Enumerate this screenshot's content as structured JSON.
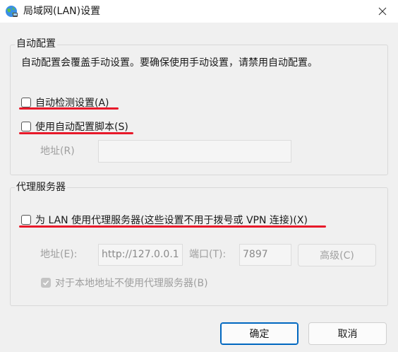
{
  "window": {
    "title": "局域网(LAN)设置",
    "icon": "globe-network-icon"
  },
  "auto_config": {
    "group_title": "自动配置",
    "description": "自动配置会覆盖手动设置。要确保使用手动设置，请禁用自动配置。",
    "auto_detect_label": "自动检测设置(A)",
    "auto_detect_checked": false,
    "use_script_label": "使用自动配置脚本(S)",
    "use_script_checked": false,
    "address_label": "地址(R)",
    "address_value": ""
  },
  "proxy": {
    "group_title": "代理服务器",
    "use_proxy_label": "为 LAN 使用代理服务器(这些设置不用于拨号或 VPN 连接)(X)",
    "use_proxy_checked": false,
    "address_label": "地址(E):",
    "address_value": "http://127.0.0.1",
    "port_label": "端口(T):",
    "port_value": "7897",
    "advanced_label": "高级(C)",
    "bypass_local_label": "对于本地地址不使用代理服务器(B)",
    "bypass_local_checked": true
  },
  "buttons": {
    "ok": "确定",
    "cancel": "取消"
  },
  "colors": {
    "annotation": "#e8192a",
    "primary_border": "#0067c0"
  }
}
